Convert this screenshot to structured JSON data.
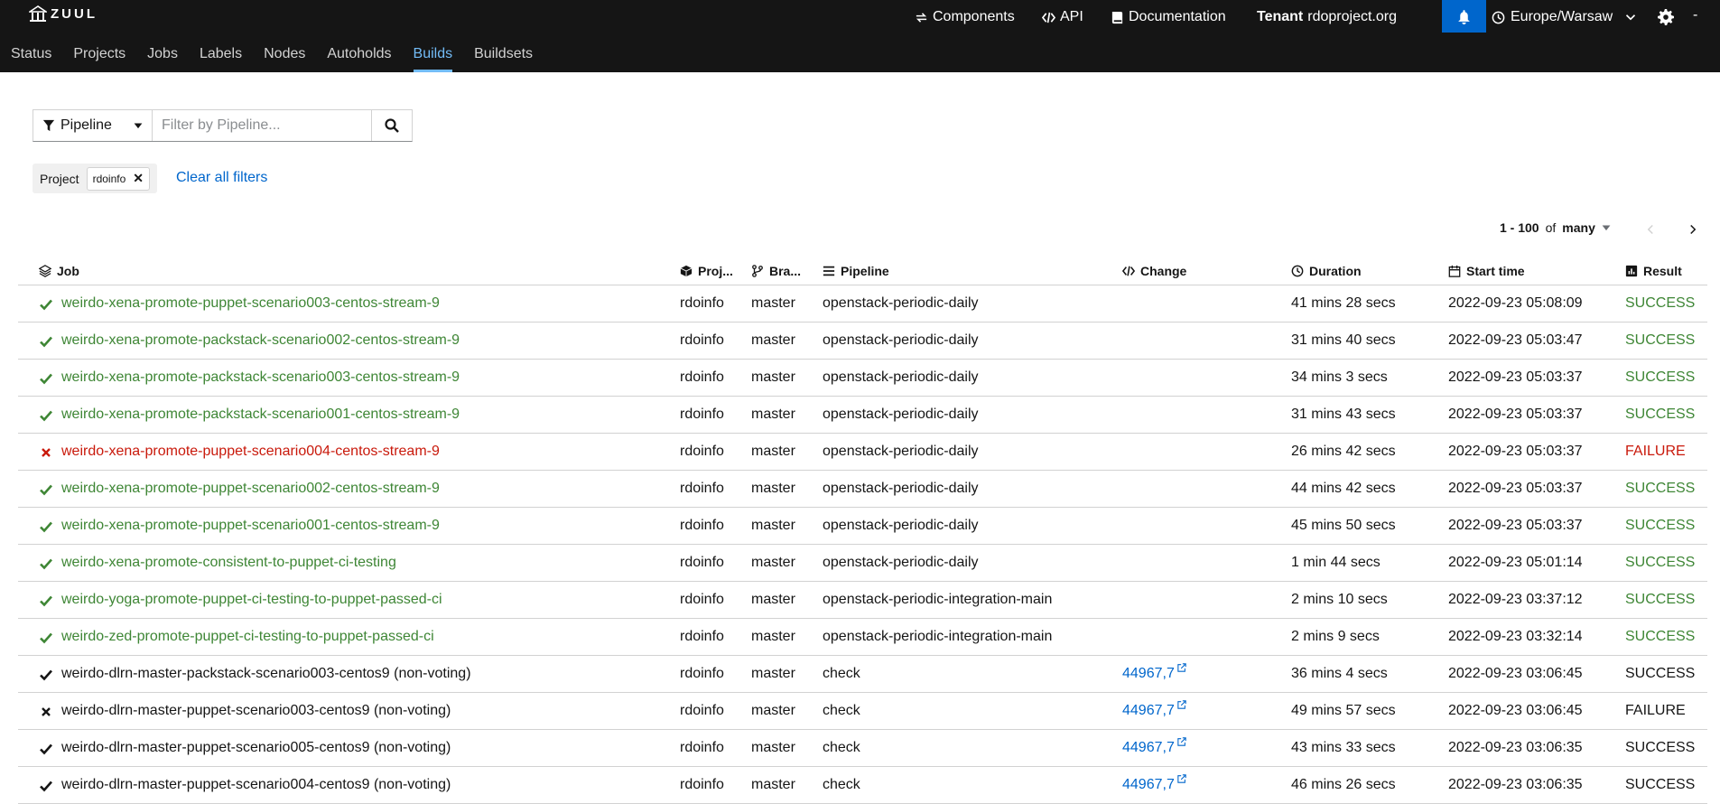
{
  "brand": {
    "name": "ZUUL"
  },
  "header": {
    "components_label": "Components",
    "api_label": "API",
    "documentation_label": "Documentation",
    "tenant_prefix": "Tenant",
    "tenant_name": "rdoproject.org",
    "timezone": "Europe/Warsaw",
    "trailing": "-"
  },
  "nav": {
    "tabs": [
      {
        "label": "Status"
      },
      {
        "label": "Projects"
      },
      {
        "label": "Jobs"
      },
      {
        "label": "Labels"
      },
      {
        "label": "Nodes"
      },
      {
        "label": "Autoholds"
      },
      {
        "label": "Builds"
      },
      {
        "label": "Buildsets"
      }
    ],
    "active": "Builds"
  },
  "filter": {
    "type_label": "Pipeline",
    "placeholder": "Filter by Pipeline..."
  },
  "chips": {
    "category": "Project",
    "value": "rdoinfo",
    "clear_all": "Clear all filters"
  },
  "pagination": {
    "range": "1 - 100",
    "of": "of",
    "total": "many"
  },
  "table": {
    "columns": {
      "job": "Job",
      "project": "Proj...",
      "branch": "Bra...",
      "pipeline": "Pipeline",
      "change": "Change",
      "duration": "Duration",
      "start": "Start time",
      "result": "Result"
    },
    "rows": [
      {
        "job": "weirdo-xena-promote-puppet-scenario003-centos-stream-9",
        "project": "rdoinfo",
        "branch": "master",
        "pipeline": "openstack-periodic-daily",
        "change": "",
        "duration": "41 mins 28 secs",
        "start": "2022-09-23 05:08:09",
        "result": "SUCCESS"
      },
      {
        "job": "weirdo-xena-promote-packstack-scenario002-centos-stream-9",
        "project": "rdoinfo",
        "branch": "master",
        "pipeline": "openstack-periodic-daily",
        "change": "",
        "duration": "31 mins 40 secs",
        "start": "2022-09-23 05:03:47",
        "result": "SUCCESS"
      },
      {
        "job": "weirdo-xena-promote-packstack-scenario003-centos-stream-9",
        "project": "rdoinfo",
        "branch": "master",
        "pipeline": "openstack-periodic-daily",
        "change": "",
        "duration": "34 mins 3 secs",
        "start": "2022-09-23 05:03:37",
        "result": "SUCCESS"
      },
      {
        "job": "weirdo-xena-promote-packstack-scenario001-centos-stream-9",
        "project": "rdoinfo",
        "branch": "master",
        "pipeline": "openstack-periodic-daily",
        "change": "",
        "duration": "31 mins 43 secs",
        "start": "2022-09-23 05:03:37",
        "result": "SUCCESS"
      },
      {
        "job": "weirdo-xena-promote-puppet-scenario004-centos-stream-9",
        "project": "rdoinfo",
        "branch": "master",
        "pipeline": "openstack-periodic-daily",
        "change": "",
        "duration": "26 mins 42 secs",
        "start": "2022-09-23 05:03:37",
        "result": "FAILURE"
      },
      {
        "job": "weirdo-xena-promote-puppet-scenario002-centos-stream-9",
        "project": "rdoinfo",
        "branch": "master",
        "pipeline": "openstack-periodic-daily",
        "change": "",
        "duration": "44 mins 42 secs",
        "start": "2022-09-23 05:03:37",
        "result": "SUCCESS"
      },
      {
        "job": "weirdo-xena-promote-puppet-scenario001-centos-stream-9",
        "project": "rdoinfo",
        "branch": "master",
        "pipeline": "openstack-periodic-daily",
        "change": "",
        "duration": "45 mins 50 secs",
        "start": "2022-09-23 05:03:37",
        "result": "SUCCESS"
      },
      {
        "job": "weirdo-xena-promote-consistent-to-puppet-ci-testing",
        "project": "rdoinfo",
        "branch": "master",
        "pipeline": "openstack-periodic-daily",
        "change": "",
        "duration": "1 min 44 secs",
        "start": "2022-09-23 05:01:14",
        "result": "SUCCESS"
      },
      {
        "job": "weirdo-yoga-promote-puppet-ci-testing-to-puppet-passed-ci",
        "project": "rdoinfo",
        "branch": "master",
        "pipeline": "openstack-periodic-integration-main",
        "change": "",
        "duration": "2 mins 10 secs",
        "start": "2022-09-23 03:37:12",
        "result": "SUCCESS"
      },
      {
        "job": "weirdo-zed-promote-puppet-ci-testing-to-puppet-passed-ci",
        "project": "rdoinfo",
        "branch": "master",
        "pipeline": "openstack-periodic-integration-main",
        "change": "",
        "duration": "2 mins 9 secs",
        "start": "2022-09-23 03:32:14",
        "result": "SUCCESS"
      },
      {
        "job": "weirdo-dlrn-master-packstack-scenario003-centos9 (non-voting)",
        "project": "rdoinfo",
        "branch": "master",
        "pipeline": "check",
        "change": "44967,7",
        "duration": "36 mins 4 secs",
        "start": "2022-09-23 03:06:45",
        "result": "SUCCESS"
      },
      {
        "job": "weirdo-dlrn-master-puppet-scenario003-centos9 (non-voting)",
        "project": "rdoinfo",
        "branch": "master",
        "pipeline": "check",
        "change": "44967,7",
        "duration": "49 mins 57 secs",
        "start": "2022-09-23 03:06:45",
        "result": "FAILURE"
      },
      {
        "job": "weirdo-dlrn-master-puppet-scenario005-centos9 (non-voting)",
        "project": "rdoinfo",
        "branch": "master",
        "pipeline": "check",
        "change": "44967,7",
        "duration": "43 mins 33 secs",
        "start": "2022-09-23 03:06:35",
        "result": "SUCCESS"
      },
      {
        "job": "weirdo-dlrn-master-puppet-scenario004-centos9 (non-voting)",
        "project": "rdoinfo",
        "branch": "master",
        "pipeline": "check",
        "change": "44967,7",
        "duration": "46 mins 26 secs",
        "start": "2022-09-23 03:06:35",
        "result": "SUCCESS"
      }
    ]
  },
  "colors": {
    "success": "#3e8635",
    "failure": "#c9190b",
    "link": "#0066cc",
    "topbar": "#151515",
    "active_tab": "#73bcf7"
  }
}
